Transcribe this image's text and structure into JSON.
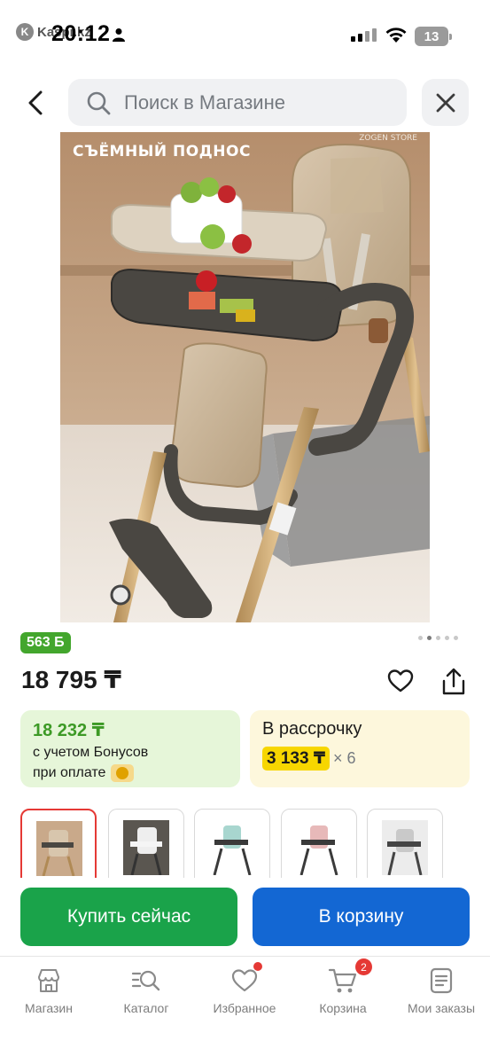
{
  "status_bar": {
    "app_badge": "Kaspi.kz",
    "time": "20:12",
    "battery": "13"
  },
  "header": {
    "search_placeholder": "Поиск в Магазине",
    "back_icon": "chevron-left-icon",
    "close_icon": "close-icon"
  },
  "product": {
    "image_caption": "СЪЁМНЫЙ ПОДНОС",
    "image_brand": "ZOGEN STORE",
    "image_count": 5,
    "active_image_index": 1,
    "bonus_badge": "563 Б",
    "price": "18 795 ₸"
  },
  "bonus_card": {
    "amount": "18 232 ₸",
    "line1": "с учетом Бонусов",
    "line2": "при оплате"
  },
  "installment_card": {
    "title": "В рассрочку",
    "monthly": "3 133 ₸",
    "multiplier": "× 6"
  },
  "actions": {
    "buy_now": "Купить сейчас",
    "add_to_cart": "В корзину"
  },
  "bottom_nav": {
    "items": [
      {
        "label": "Магазин",
        "icon": "store-icon"
      },
      {
        "label": "Каталог",
        "icon": "catalog-search-icon"
      },
      {
        "label": "Избранное",
        "icon": "heart-icon"
      },
      {
        "label": "Корзина",
        "icon": "cart-icon",
        "badge": "2"
      },
      {
        "label": "Мои заказы",
        "icon": "orders-icon"
      }
    ]
  },
  "colors": {
    "green_primary": "#1aa34a",
    "blue_primary": "#1367d3",
    "bonus_green": "#43a62d",
    "installment_yellow": "#f7d600",
    "badge_red": "#e53935"
  }
}
